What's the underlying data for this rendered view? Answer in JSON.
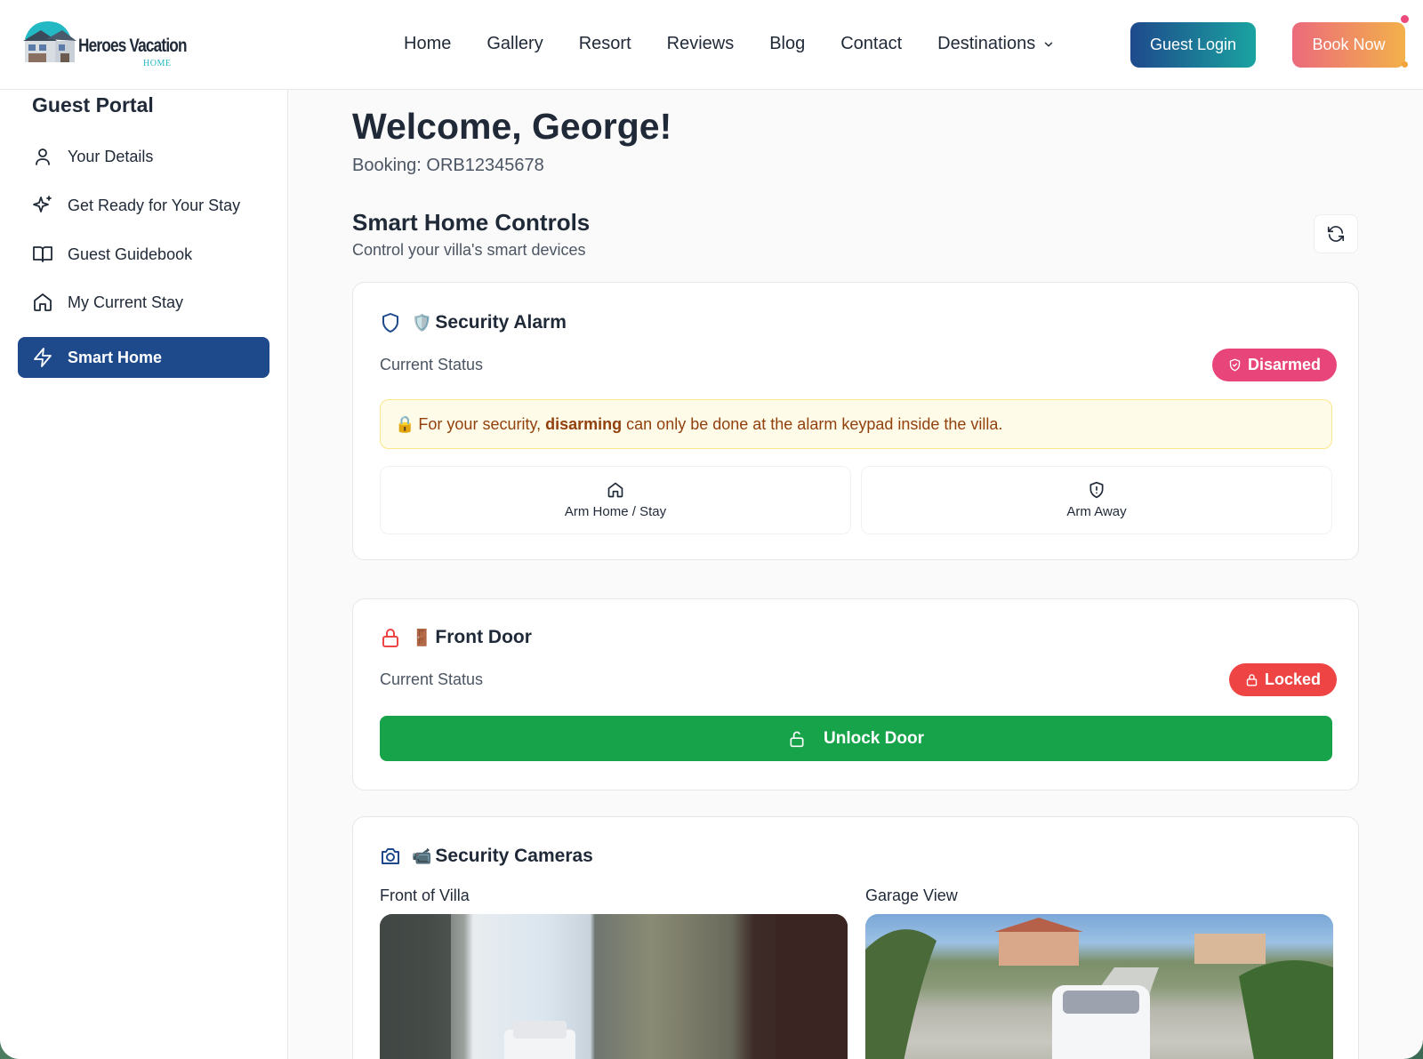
{
  "brand": {
    "name": "Heroes Vacation",
    "sub": "HOME"
  },
  "nav": {
    "items": [
      "Home",
      "Gallery",
      "Resort",
      "Reviews",
      "Blog",
      "Contact"
    ],
    "destinations": "Destinations",
    "guest_login": "Guest Login",
    "book_now": "Book Now"
  },
  "sidebar": {
    "title": "Guest Portal",
    "items": [
      {
        "label": "Your Details",
        "icon": "user-icon"
      },
      {
        "label": "Get Ready for Your Stay",
        "icon": "sparkles-icon"
      },
      {
        "label": "Guest Guidebook",
        "icon": "book-open-icon"
      },
      {
        "label": "My Current Stay",
        "icon": "home-icon"
      },
      {
        "label": "Smart Home",
        "icon": "lightning-icon",
        "active": true
      }
    ]
  },
  "main": {
    "welcome": "Welcome, George!",
    "booking": "Booking: ORB12345678",
    "section_title": "Smart Home Controls",
    "section_sub": "Control your villa's smart devices"
  },
  "alarm": {
    "title": "Security Alarm",
    "status_label": "Current Status",
    "status": "Disarmed",
    "status_color": "#e8457a",
    "notice_pre": "For your security,",
    "notice_bold": "disarming",
    "notice_post": "can only be done at the alarm keypad inside the villa.",
    "arm_home": "Arm Home / Stay",
    "arm_away": "Arm Away"
  },
  "door": {
    "title": "Front Door",
    "status_label": "Current Status",
    "status": "Locked",
    "status_color": "#ef4444",
    "unlock": "Unlock Door"
  },
  "cameras": {
    "title": "Security Cameras",
    "feeds": [
      "Front of Villa",
      "Garage View"
    ]
  },
  "colors": {
    "primary": "#1e4a8c",
    "success": "#16a34a"
  }
}
